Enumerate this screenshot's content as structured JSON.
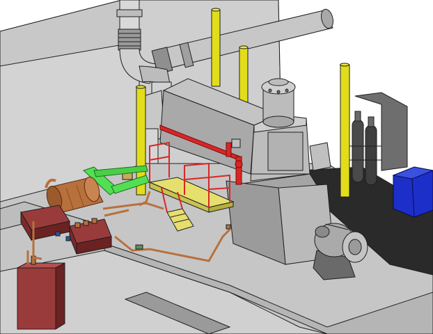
{
  "scene": {
    "kind": "3d-cad-render",
    "colors": {
      "outline": "#1e1e1e",
      "wall_light": "#d3d3d3",
      "wall_mid": "#b8b8b8",
      "wall_dark": "#8e8e8e",
      "floor": "#c8c8c8",
      "floor_dark": "#9a9a9a",
      "pit": "#2a2a2a",
      "engine_top": "#c4c4c4",
      "engine_side": "#a9a9a9",
      "engine_front": "#bdbdbd",
      "pipe_gray_light": "#d9d9d9",
      "pipe_gray_dark": "#8f8f8f",
      "yellow_post": "#e2dd1a",
      "red_pipe": "#d92626",
      "copper": "#b8703c",
      "copper_dark": "#8a4a24",
      "green_pipe": "#52e052",
      "maroon_box": "#9a3b3b",
      "blue_box": "#1d2fc9",
      "cylinder_dark": "#4a4a4a",
      "platform_yellow": "#e6df6e"
    }
  }
}
